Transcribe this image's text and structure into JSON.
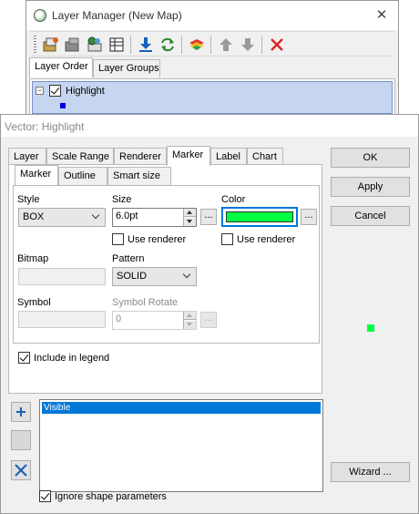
{
  "layer_manager": {
    "title": "Layer Manager (New Map)",
    "close": "✕",
    "tabs": [
      {
        "label": "Layer Order",
        "selected": true
      },
      {
        "label": "Layer Groups",
        "selected": false
      }
    ],
    "layers": [
      {
        "name": "Highlight",
        "visible": true,
        "expanded": true,
        "symbol_color": "#0000e0"
      }
    ]
  },
  "vector_dialog": {
    "title": "Vector: Highlight",
    "tabs": [
      {
        "label": "Layer"
      },
      {
        "label": "Scale Range"
      },
      {
        "label": "Renderer"
      },
      {
        "label": "Marker",
        "selected": true
      },
      {
        "label": "Label"
      },
      {
        "label": "Chart"
      }
    ],
    "marker_tabs": [
      {
        "label": "Marker",
        "selected": true
      },
      {
        "label": "Outline"
      },
      {
        "label": "Smart size"
      }
    ],
    "style_label": "Style",
    "style_value": "BOX",
    "size_label": "Size",
    "size_value": "6.0pt",
    "size_use_renderer": "Use renderer",
    "color_label": "Color",
    "color_value": "#00ff40",
    "color_use_renderer": "Use renderer",
    "bitmap_label": "Bitmap",
    "pattern_label": "Pattern",
    "pattern_value": "SOLID",
    "symbol_label": "Symbol",
    "symbol_rotate_label": "Symbol Rotate",
    "symbol_rotate_value": "0",
    "dots": "...",
    "include_in_legend": "Include in legend",
    "include_in_legend_checked": true,
    "list_items": [
      "Visible"
    ],
    "ignore_shape": "Ignore shape parameters",
    "ignore_shape_checked": true,
    "buttons": {
      "ok": "OK",
      "apply": "Apply",
      "cancel": "Cancel",
      "wizard": "Wizard ..."
    },
    "preview_color": "#00ff40"
  }
}
